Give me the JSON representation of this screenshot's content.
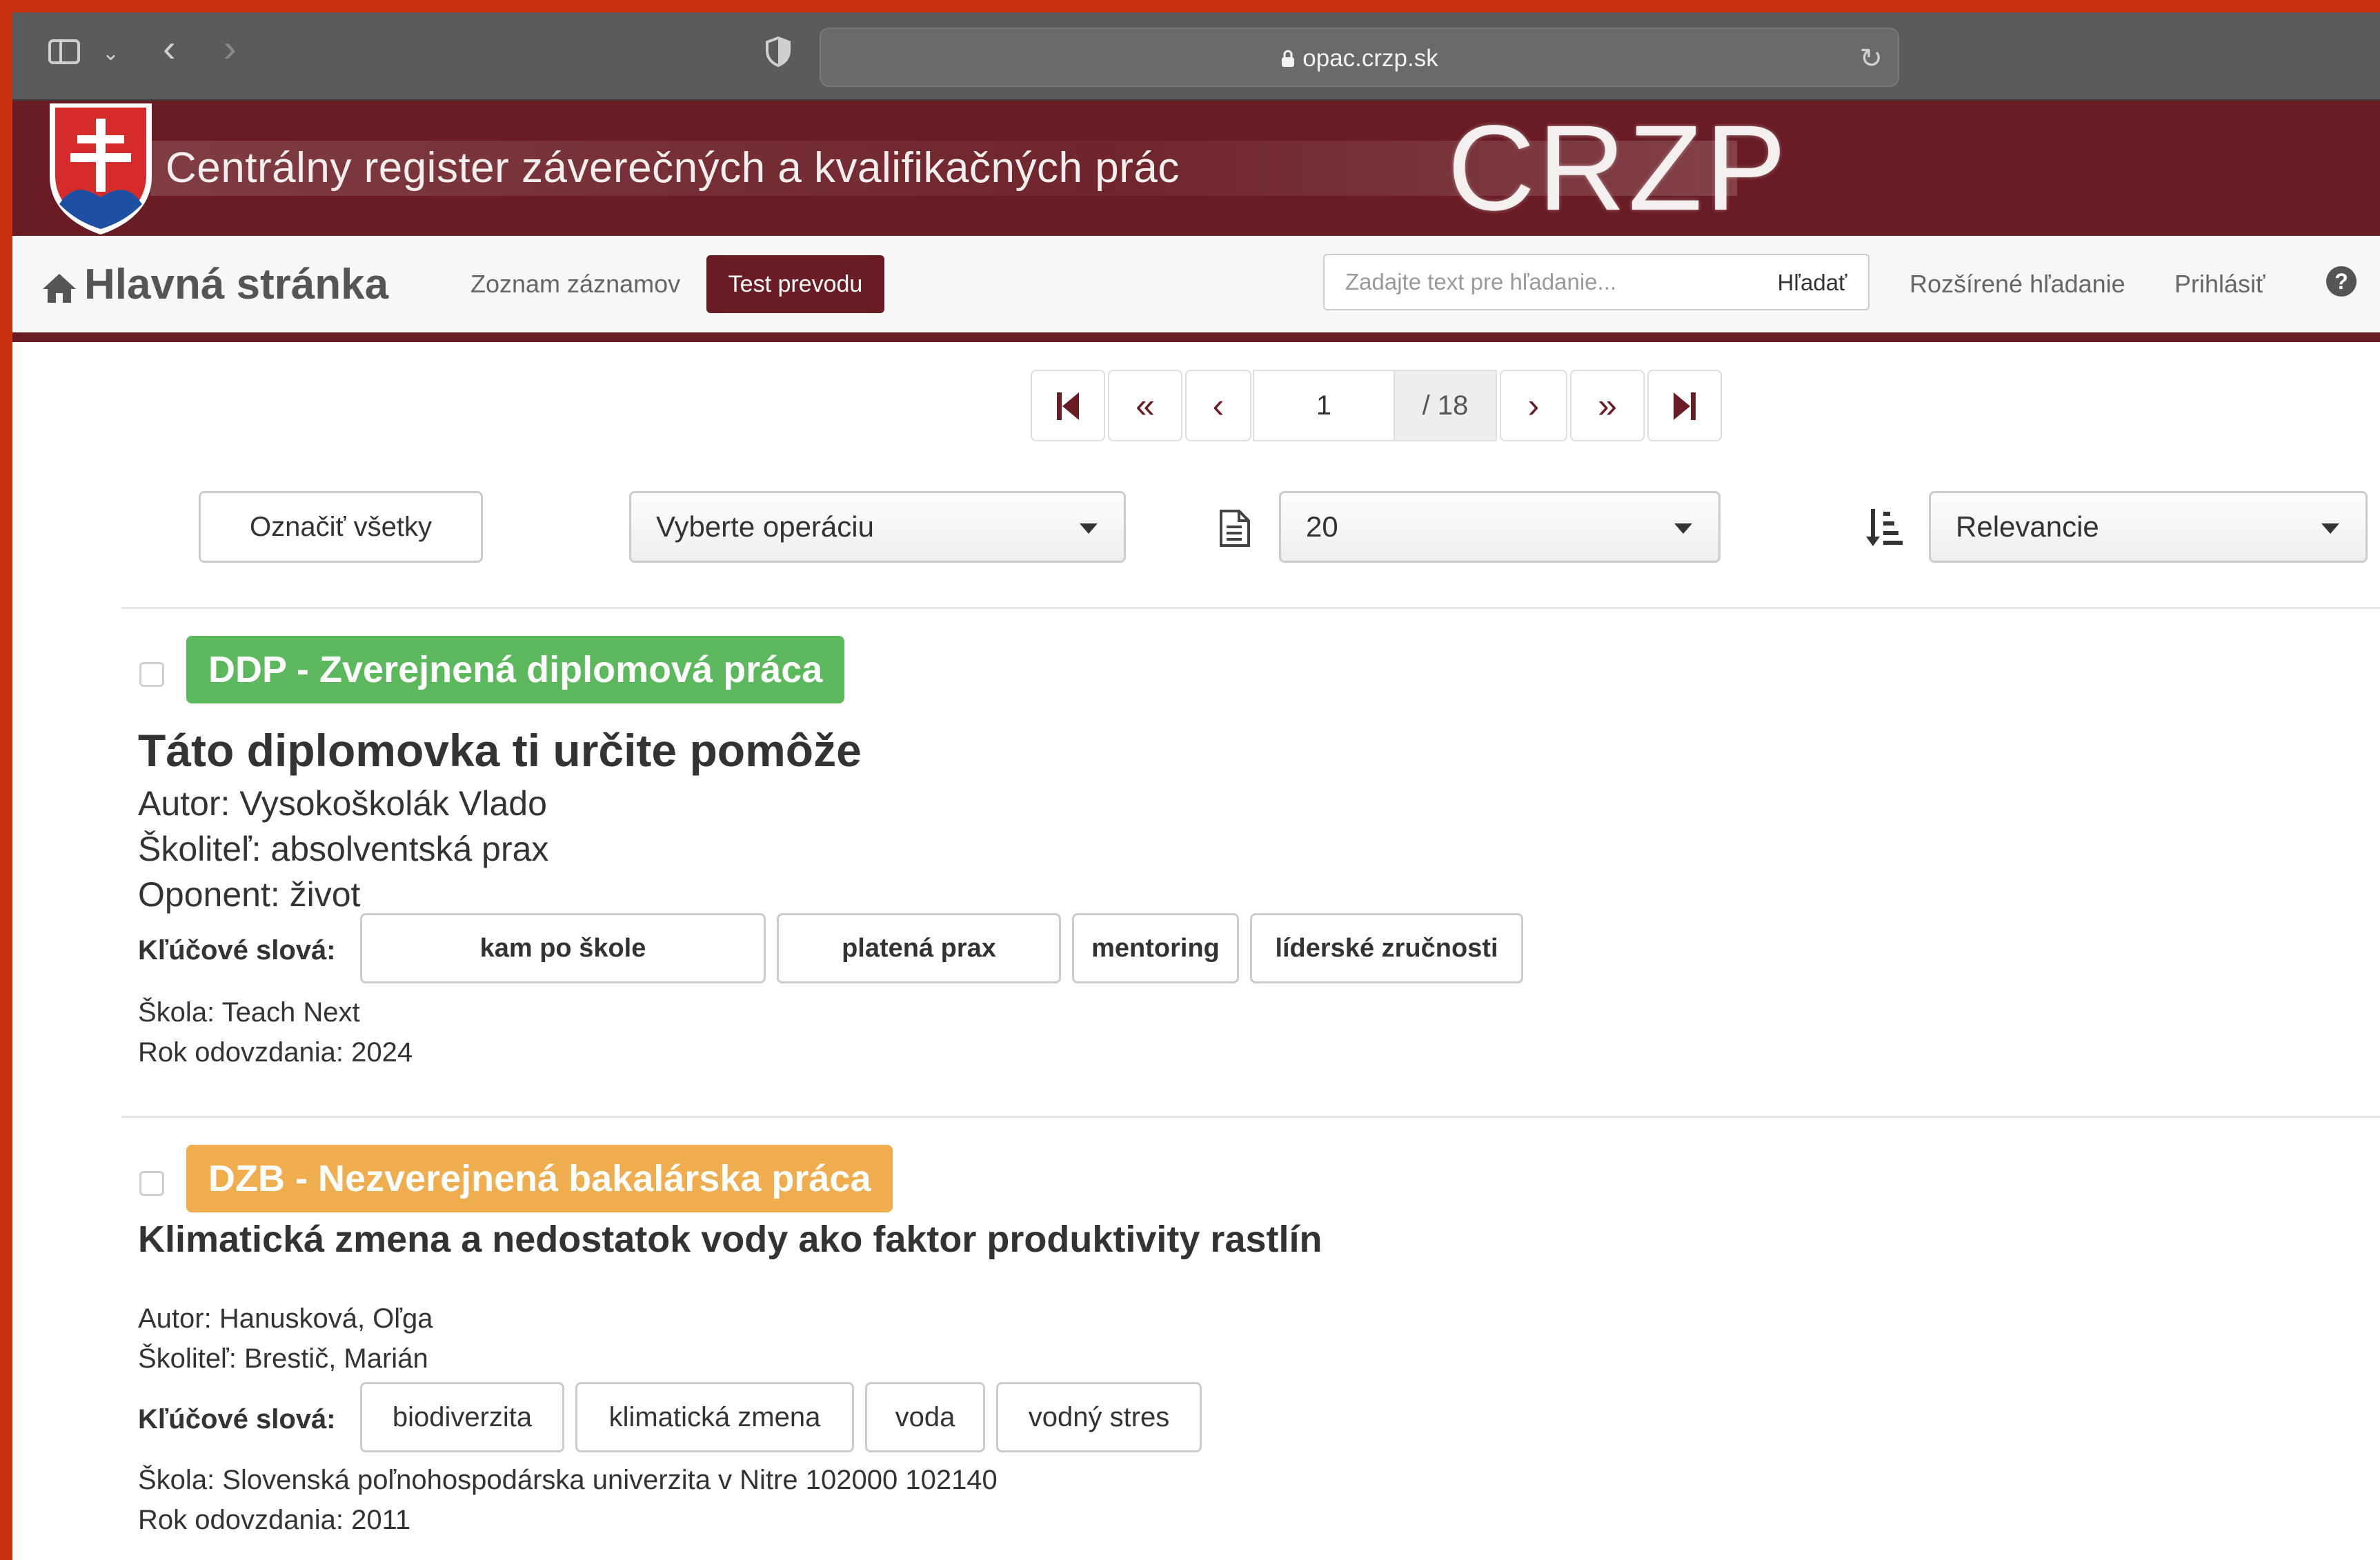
{
  "browser": {
    "url": "opac.crzp.sk"
  },
  "banner": {
    "title": "Centrálny register záverečných a kvalifikačných prác",
    "logo_text": "CRZP"
  },
  "nav": {
    "home_label": "Hlavná stránka",
    "list_label": "Zoznam záznamov",
    "test_label": "Test prevodu",
    "search_placeholder": "Zadajte text pre hľadanie...",
    "search_button": "Hľadať",
    "advanced_label": "Rozšírené hľadanie",
    "login_label": "Prihlásiť",
    "help_glyph": "?"
  },
  "pagination": {
    "current_page": "1",
    "total_label": "/ 18",
    "first_glyph": "⏮",
    "prev_fast_glyph": "«",
    "prev_glyph": "‹",
    "next_glyph": "›",
    "next_fast_glyph": "»",
    "last_glyph": "⏭"
  },
  "toolbar": {
    "select_all_label": "Označiť všetky",
    "operation_select": "Vyberte operáciu",
    "page_size": "20",
    "sort_by": "Relevancie"
  },
  "results": [
    {
      "badge": "DDP - Zverejnená diplomová práca",
      "badge_color": "#5cb85c",
      "title": "Táto diplomovka ti určite pomôže",
      "author": "Autor: Vysokoškolák Vlado",
      "supervisor": "Školiteľ: absolventská prax",
      "opponent": "Oponent: život",
      "keywords_label": "Kľúčové slová:",
      "keywords": [
        "kam po škole",
        "platená prax",
        "mentoring",
        "líderské zručnosti"
      ],
      "school": "Škola: Teach Next",
      "year": "Rok odovzdania: 2024"
    },
    {
      "badge": "DZB - Nezverejnená bakalárska práca",
      "badge_color": "#f0ad4e",
      "title": "Klimatická zmena a nedostatok vody ako faktor produktivity rastlín",
      "author": "Autor: Hanusková, Oľga",
      "supervisor": "Školiteľ: Brestič, Marián",
      "keywords_label": "Kľúčové slová:",
      "keywords": [
        "biodiverzita",
        "klimatická zmena",
        "voda",
        "vodný stres"
      ],
      "school": "Škola: Slovenská poľnohospodárska univerzita v Nitre 102000 102140",
      "year": "Rok odovzdania: 2011"
    }
  ]
}
